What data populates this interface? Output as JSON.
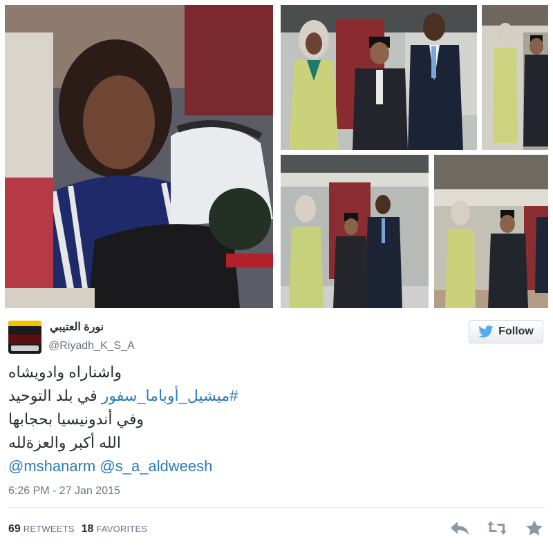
{
  "tweet": {
    "display_name": "نورة العتيبي",
    "screen_name": "@Riyadh_K_S_A",
    "follow_label": "Follow",
    "text_lines": [
      "واشناراه وادويشاه",
      "في بلد التوحيد",
      "وفي أندونيسيا بحجابها",
      "الله أكبر والعزةلله"
    ],
    "hashtag": "#ميشيل_أوباما_سفور",
    "mentions": [
      "@mshanarm",
      "@s_a_aldweesh"
    ],
    "timestamp": "6:26 PM - 27 Jan 2015",
    "retweets_count": "69",
    "retweets_label": "RETWEETS",
    "favorites_count": "18",
    "favorites_label": "FAVORITES"
  },
  "icons": {
    "follow": "twitter-bird-icon",
    "reply": "reply-icon",
    "retweet": "retweet-icon",
    "favorite": "star-icon"
  },
  "colors": {
    "link": "#2b7bb9",
    "muted": "#66757f",
    "text": "#292f33",
    "bird": "#55acee",
    "action": "#8899a6"
  }
}
